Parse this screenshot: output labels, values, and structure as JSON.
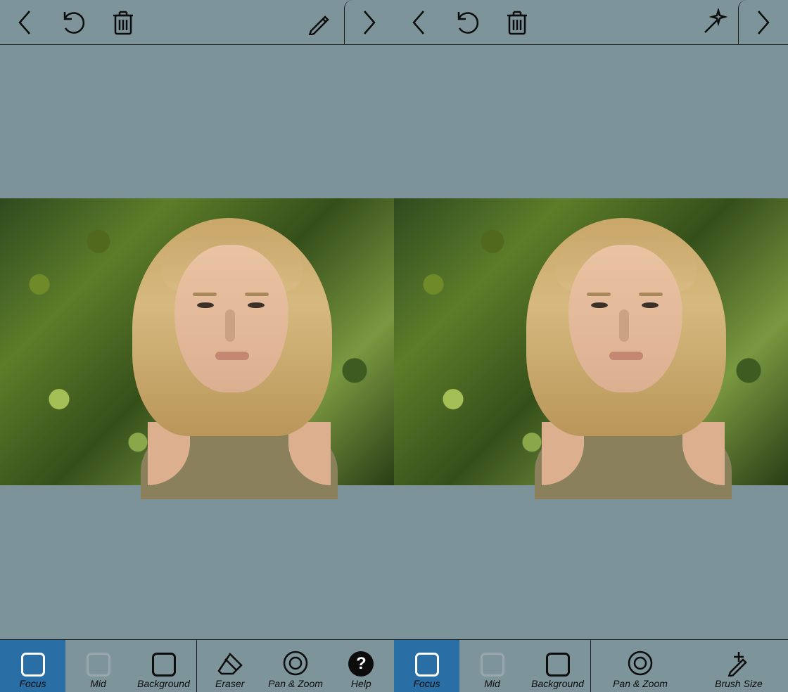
{
  "left": {
    "toolbar_right_icon": "pencil",
    "bottom": [
      {
        "label": "Focus",
        "icon": "square-white",
        "selected": true
      },
      {
        "label": "Mid",
        "icon": "square-grey"
      },
      {
        "label": "Background",
        "icon": "square-black"
      },
      {
        "label": "Eraser",
        "icon": "eraser"
      },
      {
        "label": "Pan & Zoom",
        "icon": "target"
      },
      {
        "label": "Help",
        "icon": "help"
      }
    ]
  },
  "right": {
    "toolbar_right_icon": "magic-wand",
    "bottom": [
      {
        "label": "Focus",
        "icon": "square-white",
        "selected": true
      },
      {
        "label": "Mid",
        "icon": "square-grey"
      },
      {
        "label": "Background",
        "icon": "square-black"
      },
      {
        "label": "Pan & Zoom",
        "icon": "target"
      },
      {
        "label": "Brush Size",
        "icon": "brush-size"
      }
    ]
  },
  "help_glyph": "?"
}
